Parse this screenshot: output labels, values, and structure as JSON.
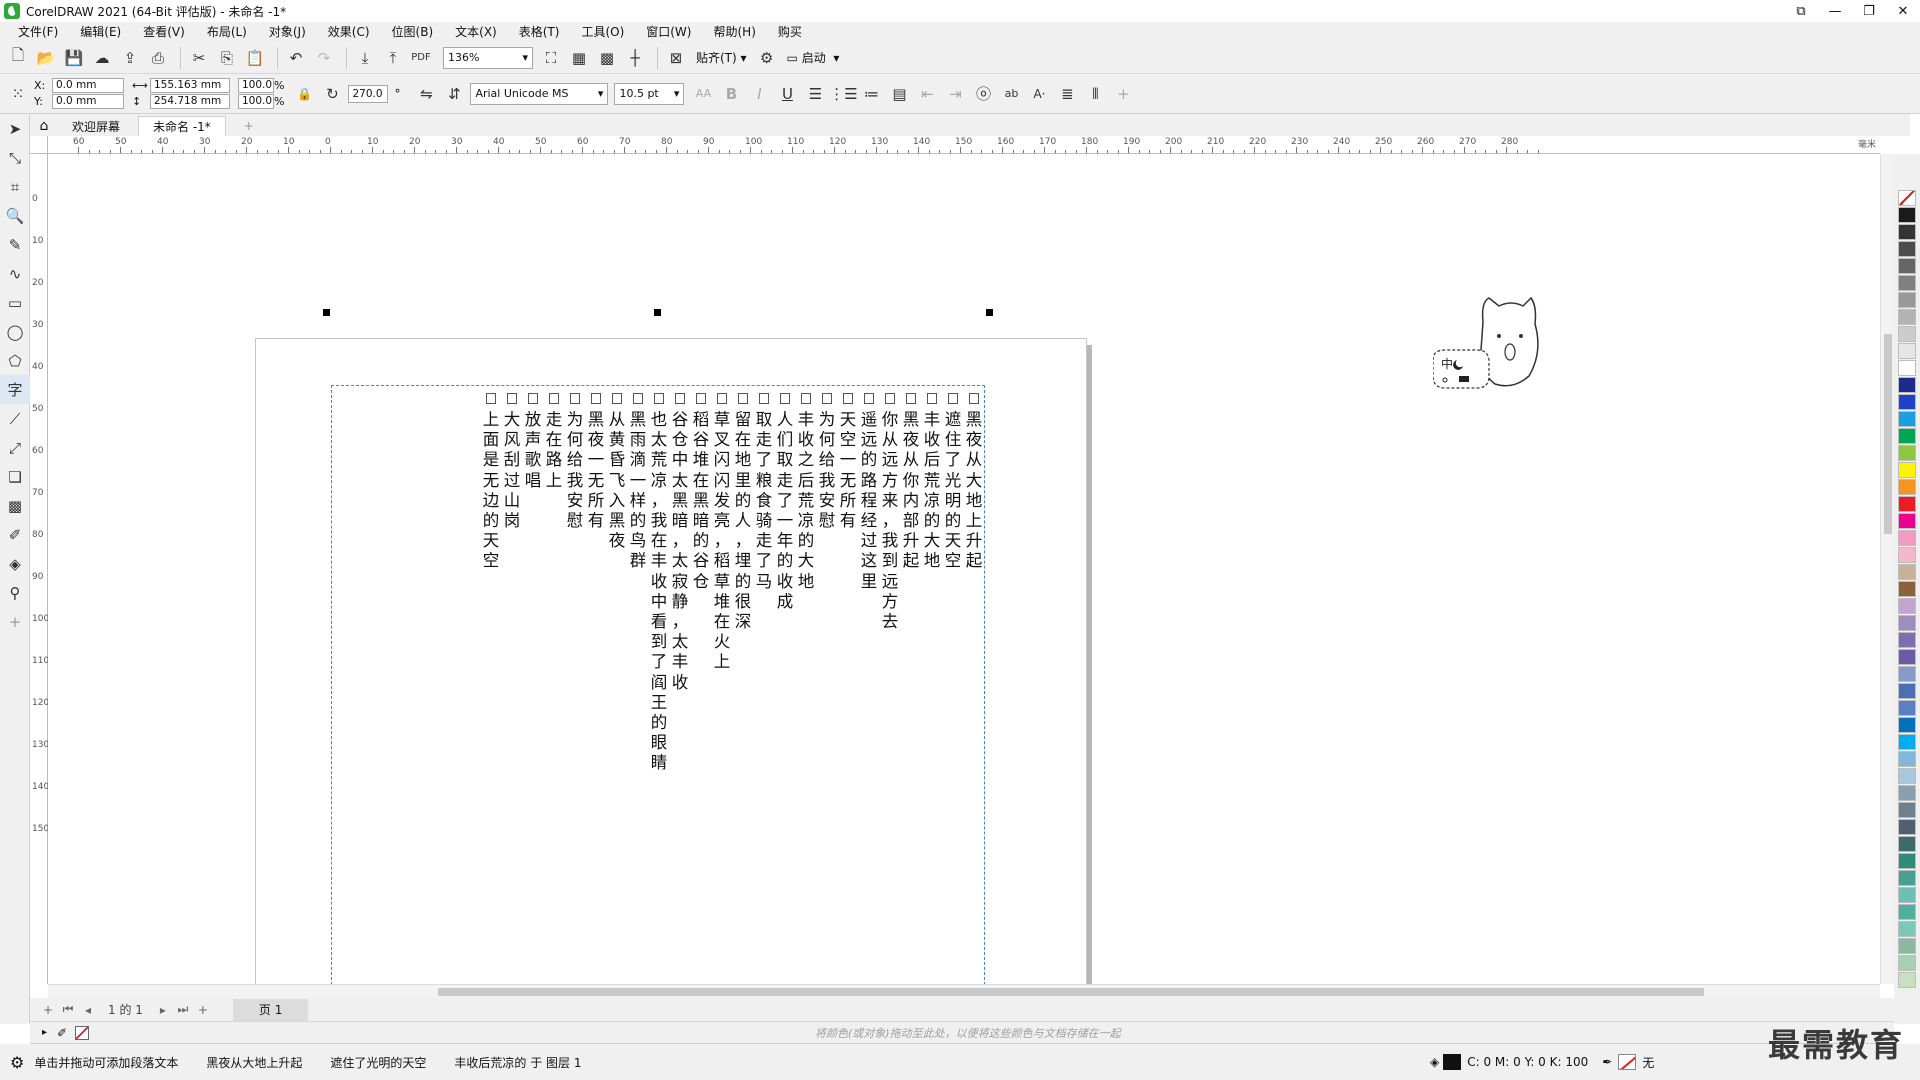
{
  "window": {
    "title": "CorelDRAW 2021 (64-Bit 评估版) - 未命名 -1*",
    "controls": [
      "⧉",
      "—",
      "❐",
      "✕"
    ]
  },
  "menu": [
    "文件(F)",
    "编辑(E)",
    "查看(V)",
    "布局(L)",
    "对象(J)",
    "效果(C)",
    "位图(B)",
    "文本(X)",
    "表格(T)",
    "工具(O)",
    "窗口(W)",
    "帮助(H)",
    "购买"
  ],
  "toolbar": {
    "zoom": "136%",
    "snap_label": "贴齐(T)",
    "launch_label": "启动"
  },
  "propbar": {
    "x_label": "X:",
    "y_label": "Y:",
    "x_value": "0.0 mm",
    "y_value": "0.0 mm",
    "width_value": "155.163 mm",
    "height_value": "254.718 mm",
    "scale_w": "100.0",
    "scale_h": "100.0",
    "percent": "%",
    "rotation": "270.0",
    "degree": "°",
    "font_name": "Arial Unicode MS",
    "font_size": "10.5 pt"
  },
  "tabs": {
    "welcome": "欢迎屏幕",
    "document": "未命名 -1*"
  },
  "ruler_top_numbers": [
    "60",
    "50",
    "40",
    "30",
    "20",
    "10",
    "0",
    "10",
    "20",
    "30",
    "40",
    "50",
    "60",
    "70",
    "80",
    "90",
    "100",
    "110",
    "120",
    "130",
    "140",
    "150",
    "160",
    "170",
    "180",
    "190",
    "200",
    "210",
    "220",
    "230",
    "240",
    "250",
    "260",
    "270",
    "280"
  ],
  "ruler_unit": "毫米",
  "ruler_left_numbers": [
    "0",
    "10",
    "20",
    "30",
    "40",
    "50",
    "60",
    "70",
    "80",
    "90",
    "100",
    "110",
    "120",
    "130",
    "140",
    "150"
  ],
  "text_columns": [
    "黑夜从大地上升起",
    "遮住了光明的天空",
    "丰收后荒凉的大地",
    "黑夜从你内部升起",
    "你从远方来，我到远方去",
    "遥远的路程经过这里",
    "天空一无所有",
    "为何给我安慰",
    "丰收之后荒凉的大地",
    "人们取走了一年的收成",
    "取走了粮食骑走了马",
    "留在地里的人，埋的很深",
    "草叉闪闪发亮，稻草堆在火上",
    "稻谷堆在黑暗的谷仓",
    "谷仓中太黑暗，太寂静，太丰收",
    "也太荒凉，我在丰收中看到了阎王的眼睛",
    "黑雨滴一样的鸟群",
    "从黄昏飞入黑夜",
    "黑夜一无所有",
    "为何给我安慰",
    "走在路上",
    "放声歌唱",
    "大风刮过山岗",
    "上面是无边的天空"
  ],
  "mascot_ime": "中",
  "pagenav": {
    "count": "1 的 1",
    "page_tab": "页 1"
  },
  "docpalette_hint": "将颜色(或对象)拖动至此处，以便将这些颜色与文档存储在一起",
  "status": {
    "hint": "单击并拖动可添加段落文本",
    "obj1": "黑夜从大地上升起",
    "obj2": "遮住了光明的天空",
    "obj3": "丰收后荒凉的 于 图层 1",
    "cmyk": "C: 0 M: 0 Y: 0 K: 100",
    "outline": "无"
  },
  "watermark": "最需教育",
  "palette_colors": [
    "#1a1a1a",
    "#333333",
    "#4d4d4d",
    "#666666",
    "#808080",
    "#999999",
    "#b3b3b3",
    "#cccccc",
    "#e6e6e6",
    "#ffffff",
    "#1c2b8c",
    "#2140c8",
    "#1aa0e0",
    "#00a651",
    "#8dc63f",
    "#fff200",
    "#f7941d",
    "#ed1c24",
    "#ec008c",
    "#f49ac1",
    "#f7b7c8",
    "#c7b299",
    "#8c6239",
    "#c2a5cf",
    "#9e8ec0",
    "#7b6fb0",
    "#6a5aa8",
    "#8a9ac8",
    "#4a6fb5",
    "#5d7ec4",
    "#0072bc",
    "#00aeef",
    "#7fb8d8",
    "#a8c8e0",
    "#8aa0b0",
    "#6d8090",
    "#506070",
    "#3d6b6b",
    "#2e8b7a",
    "#4aa090",
    "#6cc0b0",
    "#4fb0a0",
    "#7cc8b8",
    "#8ab8a0",
    "#a8d0b0",
    "#c8e0c0"
  ]
}
